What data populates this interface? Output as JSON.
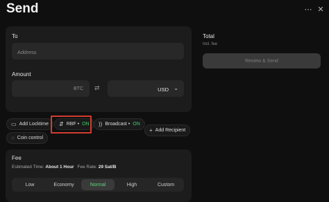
{
  "header": {
    "title": "Send"
  },
  "window": {
    "more_icon": "more-icon",
    "close_icon": "close-icon"
  },
  "to": {
    "label": "To",
    "placeholder": "Address"
  },
  "amount": {
    "label": "Amount",
    "btc_unit": "BTC",
    "currency": "USD"
  },
  "options": {
    "locktime": "Add Locktime",
    "rbf_label": "RBF •",
    "rbf_state": "ON",
    "broadcast_label": "Broadcast •",
    "broadcast_state": "ON",
    "add_recipient": "Add Recipient",
    "coin_control": "Coin control"
  },
  "summary": {
    "total_label": "Total",
    "total_sub": "Incl. fee",
    "review_button": "Review & Send"
  },
  "fee": {
    "label": "Fee",
    "est_label": "Estimated Time:",
    "est_value": "About 1 Hour",
    "rate_label": "Fee Rate:",
    "rate_value": "29 Sat/B",
    "options": [
      "Low",
      "Economy",
      "Normal",
      "High",
      "Custom"
    ],
    "selected": "Normal"
  },
  "colors": {
    "accent_green": "#3ecf6b",
    "highlight_red": "#d43b2f"
  }
}
